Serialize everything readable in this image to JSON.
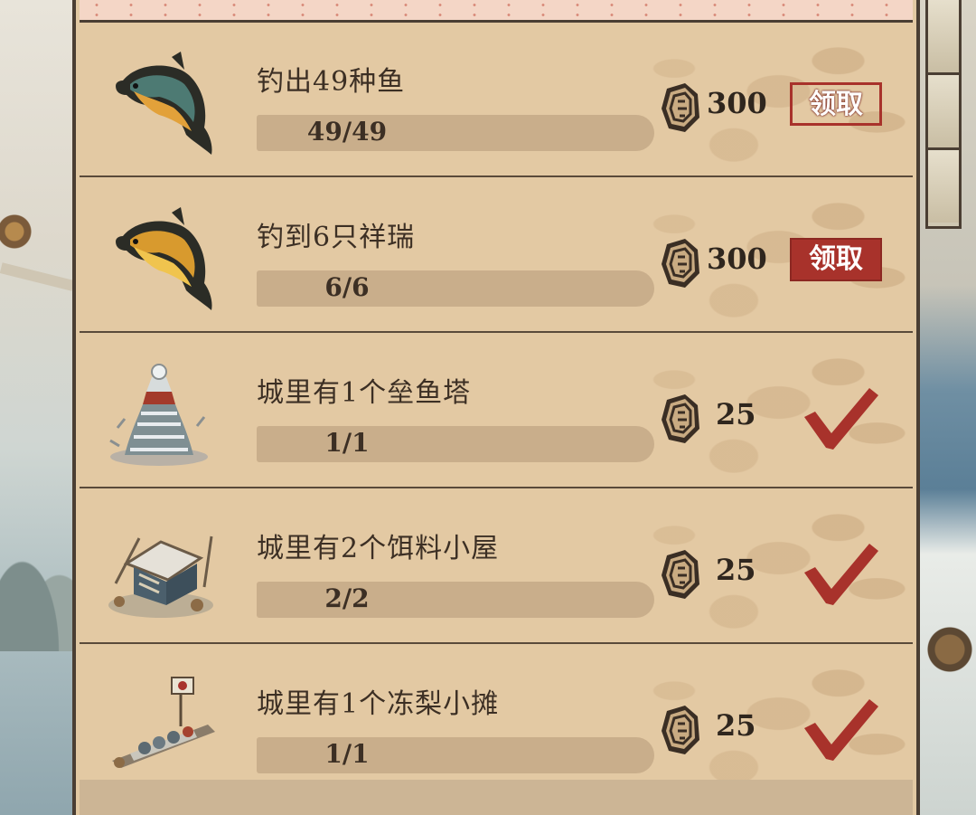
{
  "colors": {
    "panel_bg": "#e2c9a3",
    "progress_track": "#c9ae8b",
    "accent_red": "#a8322b",
    "border_dark": "#4a3e33"
  },
  "tasks": [
    {
      "title": "钓出49种鱼",
      "progress_text": "49/49",
      "progress_fraction": 1.0,
      "reward": "300",
      "status": "claim-outline",
      "button_label": "领取",
      "icon": "carp-fish-icon"
    },
    {
      "title": "钓到6只祥瑞",
      "progress_text": "6/6",
      "progress_fraction": 1.0,
      "reward": "300",
      "status": "claim-filled",
      "button_label": "领取",
      "icon": "golden-fish-icon"
    },
    {
      "title": "城里有1个垒鱼塔",
      "progress_text": "1/1",
      "progress_fraction": 1.0,
      "reward": "25",
      "status": "done",
      "icon": "fish-tower-icon"
    },
    {
      "title": "城里有2个饵料小屋",
      "progress_text": "2/2",
      "progress_fraction": 1.0,
      "reward": "25",
      "status": "done",
      "icon": "bait-hut-icon"
    },
    {
      "title": "城里有1个冻梨小摊",
      "progress_text": "1/1",
      "progress_fraction": 1.0,
      "reward": "25",
      "status": "done",
      "icon": "frozen-pear-stall-icon"
    }
  ],
  "reward_icon": "copper-coin-icon",
  "done_icon": "red-checkmark-icon"
}
